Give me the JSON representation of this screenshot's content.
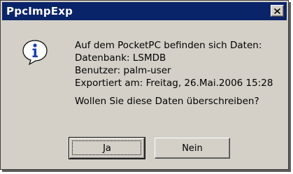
{
  "window": {
    "title": "PpcImpExp",
    "close_icon": "close-icon"
  },
  "dialog": {
    "icon": "info-icon",
    "message_lines": [
      "Auf dem PocketPC befinden sich Daten:",
      "Datenbank: LSMDB",
      "Benutzer: palm-user",
      "Exportiert am: Freitag, 26.Mai.2006 15:28"
    ],
    "question": "Wollen Sie diese Daten überschreiben?"
  },
  "buttons": {
    "yes_label": "Ja",
    "no_label": "Nein"
  },
  "colors": {
    "titlebar": "#0a246a",
    "face": "#d4d0c8",
    "icon_blue": "#1c3fb8"
  }
}
